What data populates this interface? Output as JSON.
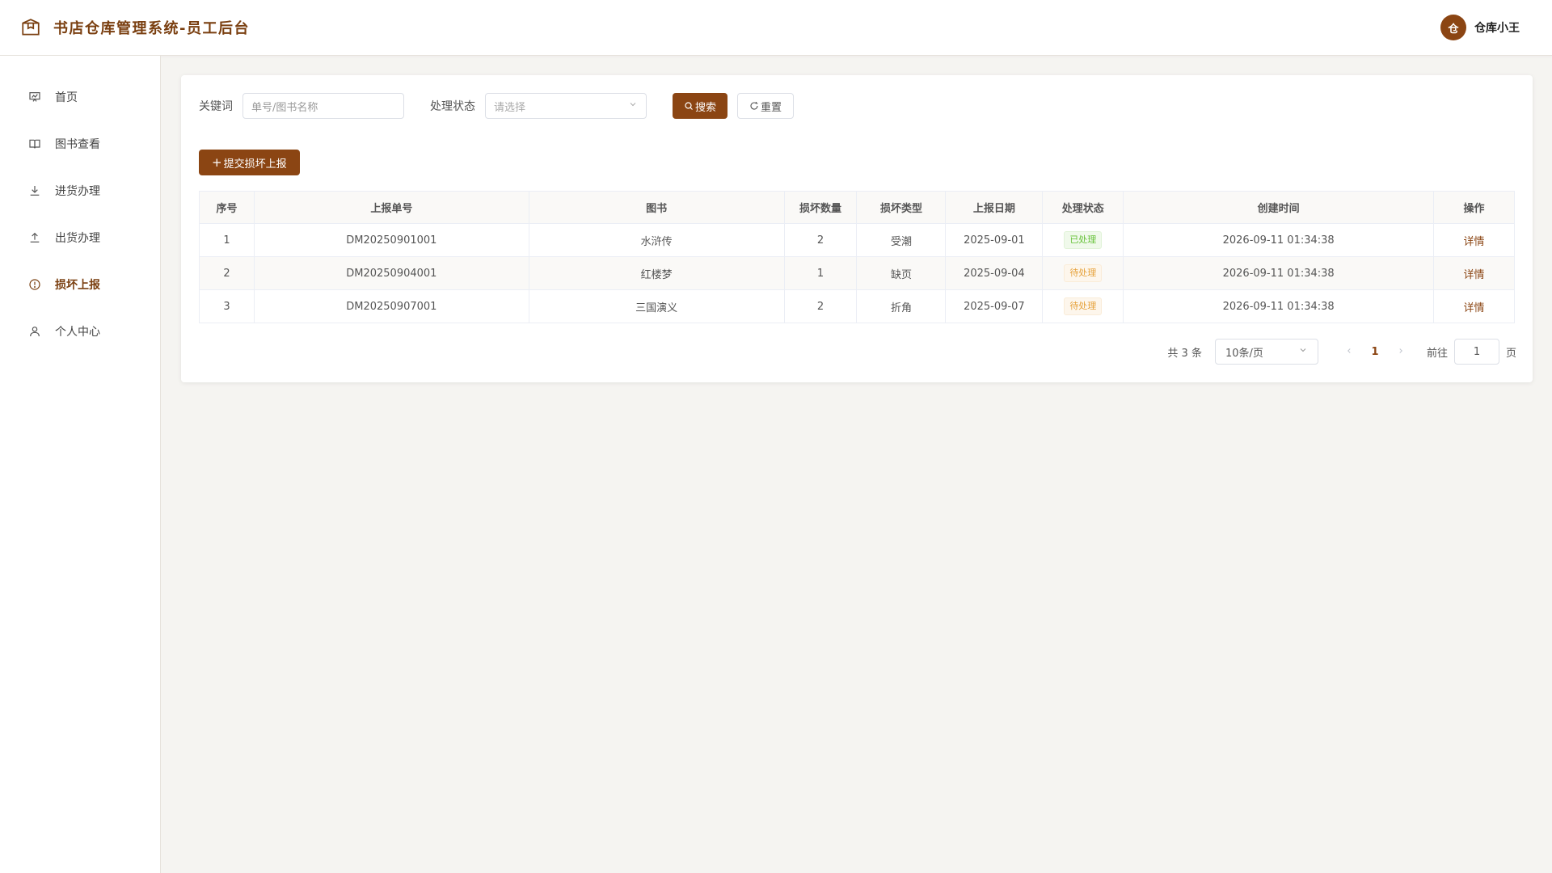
{
  "header": {
    "title": "书店仓库管理系统-员工后台",
    "user_avatar_text": "仓",
    "username": "仓库小王"
  },
  "sidebar": {
    "items": [
      {
        "label": "首页",
        "icon": "dashboard-icon"
      },
      {
        "label": "图书查看",
        "icon": "book-icon"
      },
      {
        "label": "进货办理",
        "icon": "download-icon"
      },
      {
        "label": "出货办理",
        "icon": "upload-icon"
      },
      {
        "label": "损坏上报",
        "icon": "warning-circle-icon",
        "active": true
      },
      {
        "label": "个人中心",
        "icon": "user-icon"
      }
    ]
  },
  "filters": {
    "keyword_label": "关键词",
    "keyword_placeholder": "单号/图书名称",
    "status_label": "处理状态",
    "status_placeholder": "请选择",
    "search_label": "搜索",
    "reset_label": "重置"
  },
  "add_button_label": "提交损坏上报",
  "table": {
    "columns": [
      "序号",
      "上报单号",
      "图书",
      "损坏数量",
      "损坏类型",
      "上报日期",
      "处理状态",
      "创建时间",
      "操作"
    ],
    "rows": [
      {
        "index": "1",
        "order_no": "DM20250901001",
        "book": "水浒传",
        "qty": "2",
        "type": "受潮",
        "date": "2025-09-01",
        "status": "已处理",
        "created": "2026-09-11 01:34:38",
        "action": "详情"
      },
      {
        "index": "2",
        "order_no": "DM20250904001",
        "book": "红楼梦",
        "qty": "1",
        "type": "缺页",
        "date": "2025-09-04",
        "status": "待处理",
        "created": "2026-09-11 01:34:38",
        "action": "详情"
      },
      {
        "index": "3",
        "order_no": "DM20250907001",
        "book": "三国演义",
        "qty": "2",
        "type": "折角",
        "date": "2025-09-07",
        "status": "待处理",
        "created": "2026-09-11 01:34:38",
        "action": "详情"
      }
    ]
  },
  "pagination": {
    "total_text": "共 3 条",
    "page_size": "10条/页",
    "current_page": "1",
    "goto_label": "前往",
    "goto_value": "1",
    "page_suffix": "页"
  },
  "colors": {
    "accent": "#8b4513",
    "success": "#67c23a",
    "warning": "#e6a23c"
  }
}
